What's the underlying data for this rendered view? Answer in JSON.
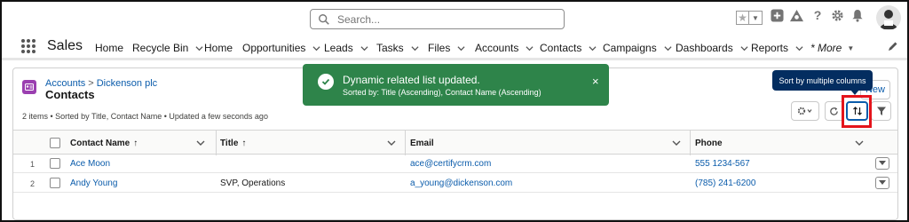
{
  "global_header": {
    "search_placeholder": "Search...",
    "icons": [
      "star-icon",
      "chevron-down-icon",
      "add-icon",
      "trailhead-icon",
      "help-icon",
      "setup-gear-icon",
      "notifications-bell-icon",
      "user-avatar"
    ]
  },
  "app_nav": {
    "app_name": "Sales",
    "items": [
      {
        "label": "Home",
        "has_menu": false
      },
      {
        "label": "Recycle Bin",
        "has_menu": true
      },
      {
        "label": "Home",
        "has_menu": false
      },
      {
        "label": "Opportunities",
        "has_menu": true
      },
      {
        "label": "Leads",
        "has_menu": true
      },
      {
        "label": "Tasks",
        "has_menu": true
      },
      {
        "label": "Files",
        "has_menu": true
      },
      {
        "label": "Accounts",
        "has_menu": true
      },
      {
        "label": "Contacts",
        "has_menu": true
      },
      {
        "label": "Campaigns",
        "has_menu": true
      },
      {
        "label": "Dashboards",
        "has_menu": true
      },
      {
        "label": "Reports",
        "has_menu": true
      }
    ],
    "more_label": "* More"
  },
  "related_list": {
    "breadcrumb_parent": "Accounts",
    "breadcrumb_separator": ">",
    "breadcrumb_record": "Dickenson plc",
    "title": "Contacts",
    "info": "2 items • Sorted by Title, Contact Name • Updated a few seconds ago",
    "new_button": "New",
    "columns": [
      {
        "label": "Contact Name",
        "sort_arrow": "↑"
      },
      {
        "label": "Title",
        "sort_arrow": "↑"
      },
      {
        "label": "Email",
        "sort_arrow": ""
      },
      {
        "label": "Phone",
        "sort_arrow": ""
      }
    ],
    "rows": [
      {
        "num": "1",
        "name": "Ace Moon",
        "title": "",
        "email": "ace@certifycrm.com",
        "phone": "555 1234-567"
      },
      {
        "num": "2",
        "name": "Andy Young",
        "title": "SVP, Operations",
        "email": "a_young@dickenson.com",
        "phone": "(785) 241-6200"
      }
    ]
  },
  "toast": {
    "title": "Dynamic related list updated.",
    "message": "Sorted by: Title (Ascending), Contact Name (Ascending)",
    "close": "×",
    "color": "#2e844a"
  },
  "tooltip": {
    "text": "Sort by multiple columns"
  },
  "colors": {
    "link": "#0b5cab",
    "highlight": "#e4141b",
    "tooltip": "#032d60",
    "object_icon": "#9b3fb0"
  }
}
